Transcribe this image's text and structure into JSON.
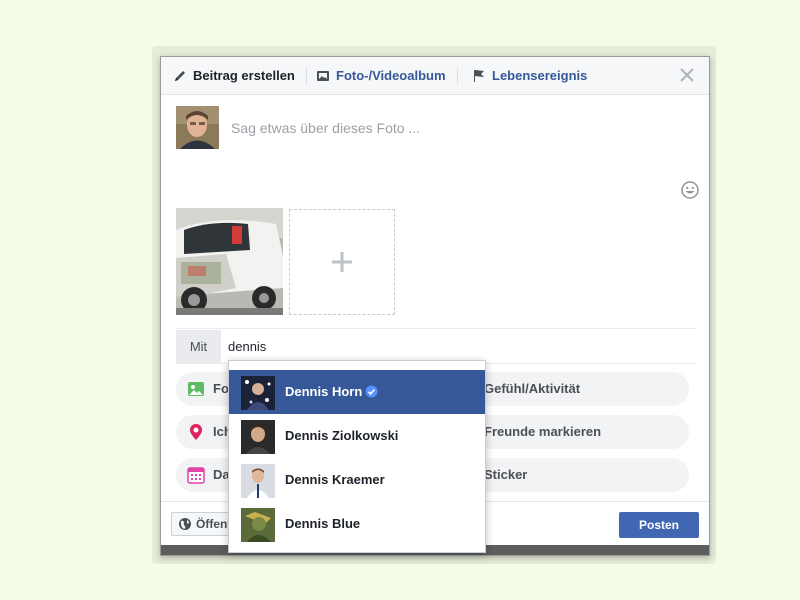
{
  "tabs": {
    "post": "Beitrag erstellen",
    "photo_album": "Foto-/Videoalbum",
    "life_event": "Lebensereignis"
  },
  "composer": {
    "placeholder": "Sag etwas über dieses Foto ..."
  },
  "with": {
    "label": "Mit",
    "value": "dennis"
  },
  "options": [
    {
      "label": "Foto/Video",
      "icon": "photo-icon"
    },
    {
      "label": "Gefühl/Aktivität",
      "icon": "feeling-icon"
    },
    {
      "label": "Ich bin hier",
      "icon": "location-pin-icon"
    },
    {
      "label": "Freunde markieren",
      "icon": "tag-friends-icon"
    },
    {
      "label": "Datum",
      "icon": "calendar-icon"
    },
    {
      "label": "Sticker",
      "icon": "sticker-icon"
    }
  ],
  "footer": {
    "privacy": "Öffentlich",
    "post": "Posten"
  },
  "suggestions": [
    {
      "name": "Dennis Horn",
      "verified": true
    },
    {
      "name": "Dennis Ziolkowski"
    },
    {
      "name": "Dennis Kraemer"
    },
    {
      "name": "Dennis Blue"
    }
  ],
  "colors": {
    "accent": "#4267b2",
    "link": "#365899",
    "selected": "#365899",
    "background": "#f4fbe6"
  }
}
